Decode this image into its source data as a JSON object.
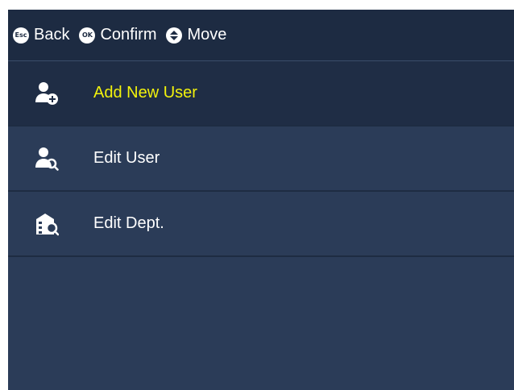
{
  "header": {
    "back_icon": "Esc",
    "back_label": "Back",
    "confirm_icon": "OK",
    "confirm_label": "Confirm",
    "move_icon": "up-down-arrows-icon",
    "move_label": "Move"
  },
  "menu": {
    "items": [
      {
        "label": "Add New User",
        "icon": "add-user-icon",
        "selected": true
      },
      {
        "label": "Edit User",
        "icon": "search-user-icon",
        "selected": false
      },
      {
        "label": "Edit Dept.",
        "icon": "department-search-icon",
        "selected": false
      }
    ]
  },
  "colors": {
    "background": "#2b3c58",
    "header_background": "#1d2b42",
    "selected_background": "#1f2d45",
    "selected_text": "#f2f20c",
    "text": "#ffffff"
  }
}
